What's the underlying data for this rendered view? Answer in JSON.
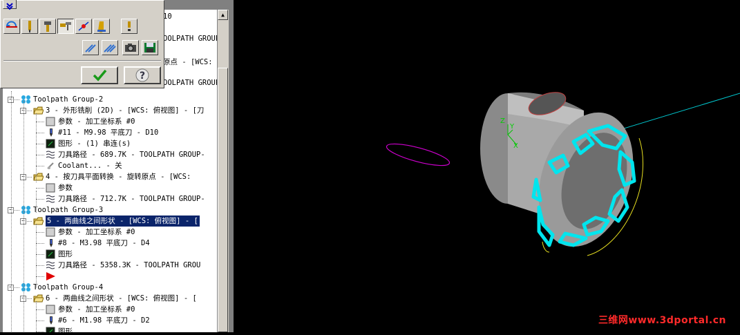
{
  "tree": {
    "partials": [
      "10",
      "OOLPATH GROUP-",
      "原点 - [WCS:",
      "OOLPATH GROUP-"
    ],
    "rows": [
      {
        "label": "Toolpath Group-2",
        "icon": "toolpath-group-icon",
        "level": 0,
        "exp": "−"
      },
      {
        "label": "3 - 外形铣削 (2D) - [WCS: 俯视图] - [刀",
        "icon": "folder-icon",
        "level": 1,
        "exp": "−"
      },
      {
        "label": "参数 - 加工坐标系 #0",
        "icon": "parameters-icon",
        "level": 2
      },
      {
        "label": "#11 - M9.98 平底刀 - D10",
        "icon": "tool-icon",
        "level": 2
      },
      {
        "label": "图形 - (1) 串连(s)",
        "icon": "geometry-icon",
        "level": 2
      },
      {
        "label": "刀具路径 - 689.7K - TOOLPATH GROUP-",
        "icon": "toolpath-icon",
        "level": 2
      },
      {
        "label": "Coolant... - 关",
        "icon": "coolant-icon",
        "level": 2
      },
      {
        "label": "4 - 按刀具平面转换 - 旋转原点 - [WCS:",
        "icon": "folder-icon",
        "level": 1,
        "exp": "−"
      },
      {
        "label": "参数",
        "icon": "parameters-icon",
        "level": 2
      },
      {
        "label": "刀具路径 - 712.7K - TOOLPATH GROUP-",
        "icon": "toolpath-icon",
        "level": 2
      },
      {
        "label": "Toolpath Group-3",
        "icon": "toolpath-group-icon",
        "level": 0,
        "exp": "−"
      },
      {
        "label": "5 - 两曲线之间形状 - [WCS: 俯视图] - [",
        "icon": "folder-icon",
        "level": 1,
        "exp": "−",
        "selected": true
      },
      {
        "label": "参数 - 加工坐标系 #0",
        "icon": "parameters-icon",
        "level": 2
      },
      {
        "label": "#8 - M3.98 平底刀 - D4",
        "icon": "tool-icon",
        "level": 2
      },
      {
        "label": "图形",
        "icon": "geometry-icon",
        "level": 2
      },
      {
        "label": "刀具路径 - 5358.3K - TOOLPATH GROU",
        "icon": "toolpath-icon",
        "level": 2
      },
      {
        "label": "",
        "icon": "insert-arrow-icon",
        "level": 2
      },
      {
        "label": "Toolpath Group-4",
        "icon": "toolpath-group-icon",
        "level": 0,
        "exp": "−"
      },
      {
        "label": "6 - 两曲线之间形状 - [WCS: 俯视图] - [",
        "icon": "folder-icon",
        "level": 1,
        "exp": "−"
      },
      {
        "label": "参数 - 加工坐标系 #0",
        "icon": "parameters-icon",
        "level": 2
      },
      {
        "label": "#6 - M1.98 平底刀 - D2",
        "icon": "tool-icon",
        "level": 2
      },
      {
        "label": "图形",
        "icon": "geometry-icon",
        "level": 2
      }
    ]
  },
  "palette": {
    "row1": [
      "regen-icon",
      "tool-manager-icon",
      "tool-pin-icon",
      "toolpath-select-icon",
      "backplot-icon",
      "verify-icon"
    ],
    "help_icon": "exclamation-icon",
    "row2": [
      "lock-icon",
      "post-icon",
      "camera-icon",
      "save-icon"
    ]
  },
  "viewport": {
    "axis_x": "X",
    "axis_y": "Y",
    "axis_z": "Z",
    "watermark": "三维网www.3dportal.cn"
  },
  "colors": {
    "selection": "#0a246a",
    "toolpath": "#00e5ee",
    "wire": "#ff00ff",
    "watermark": "#ff2a2a"
  }
}
